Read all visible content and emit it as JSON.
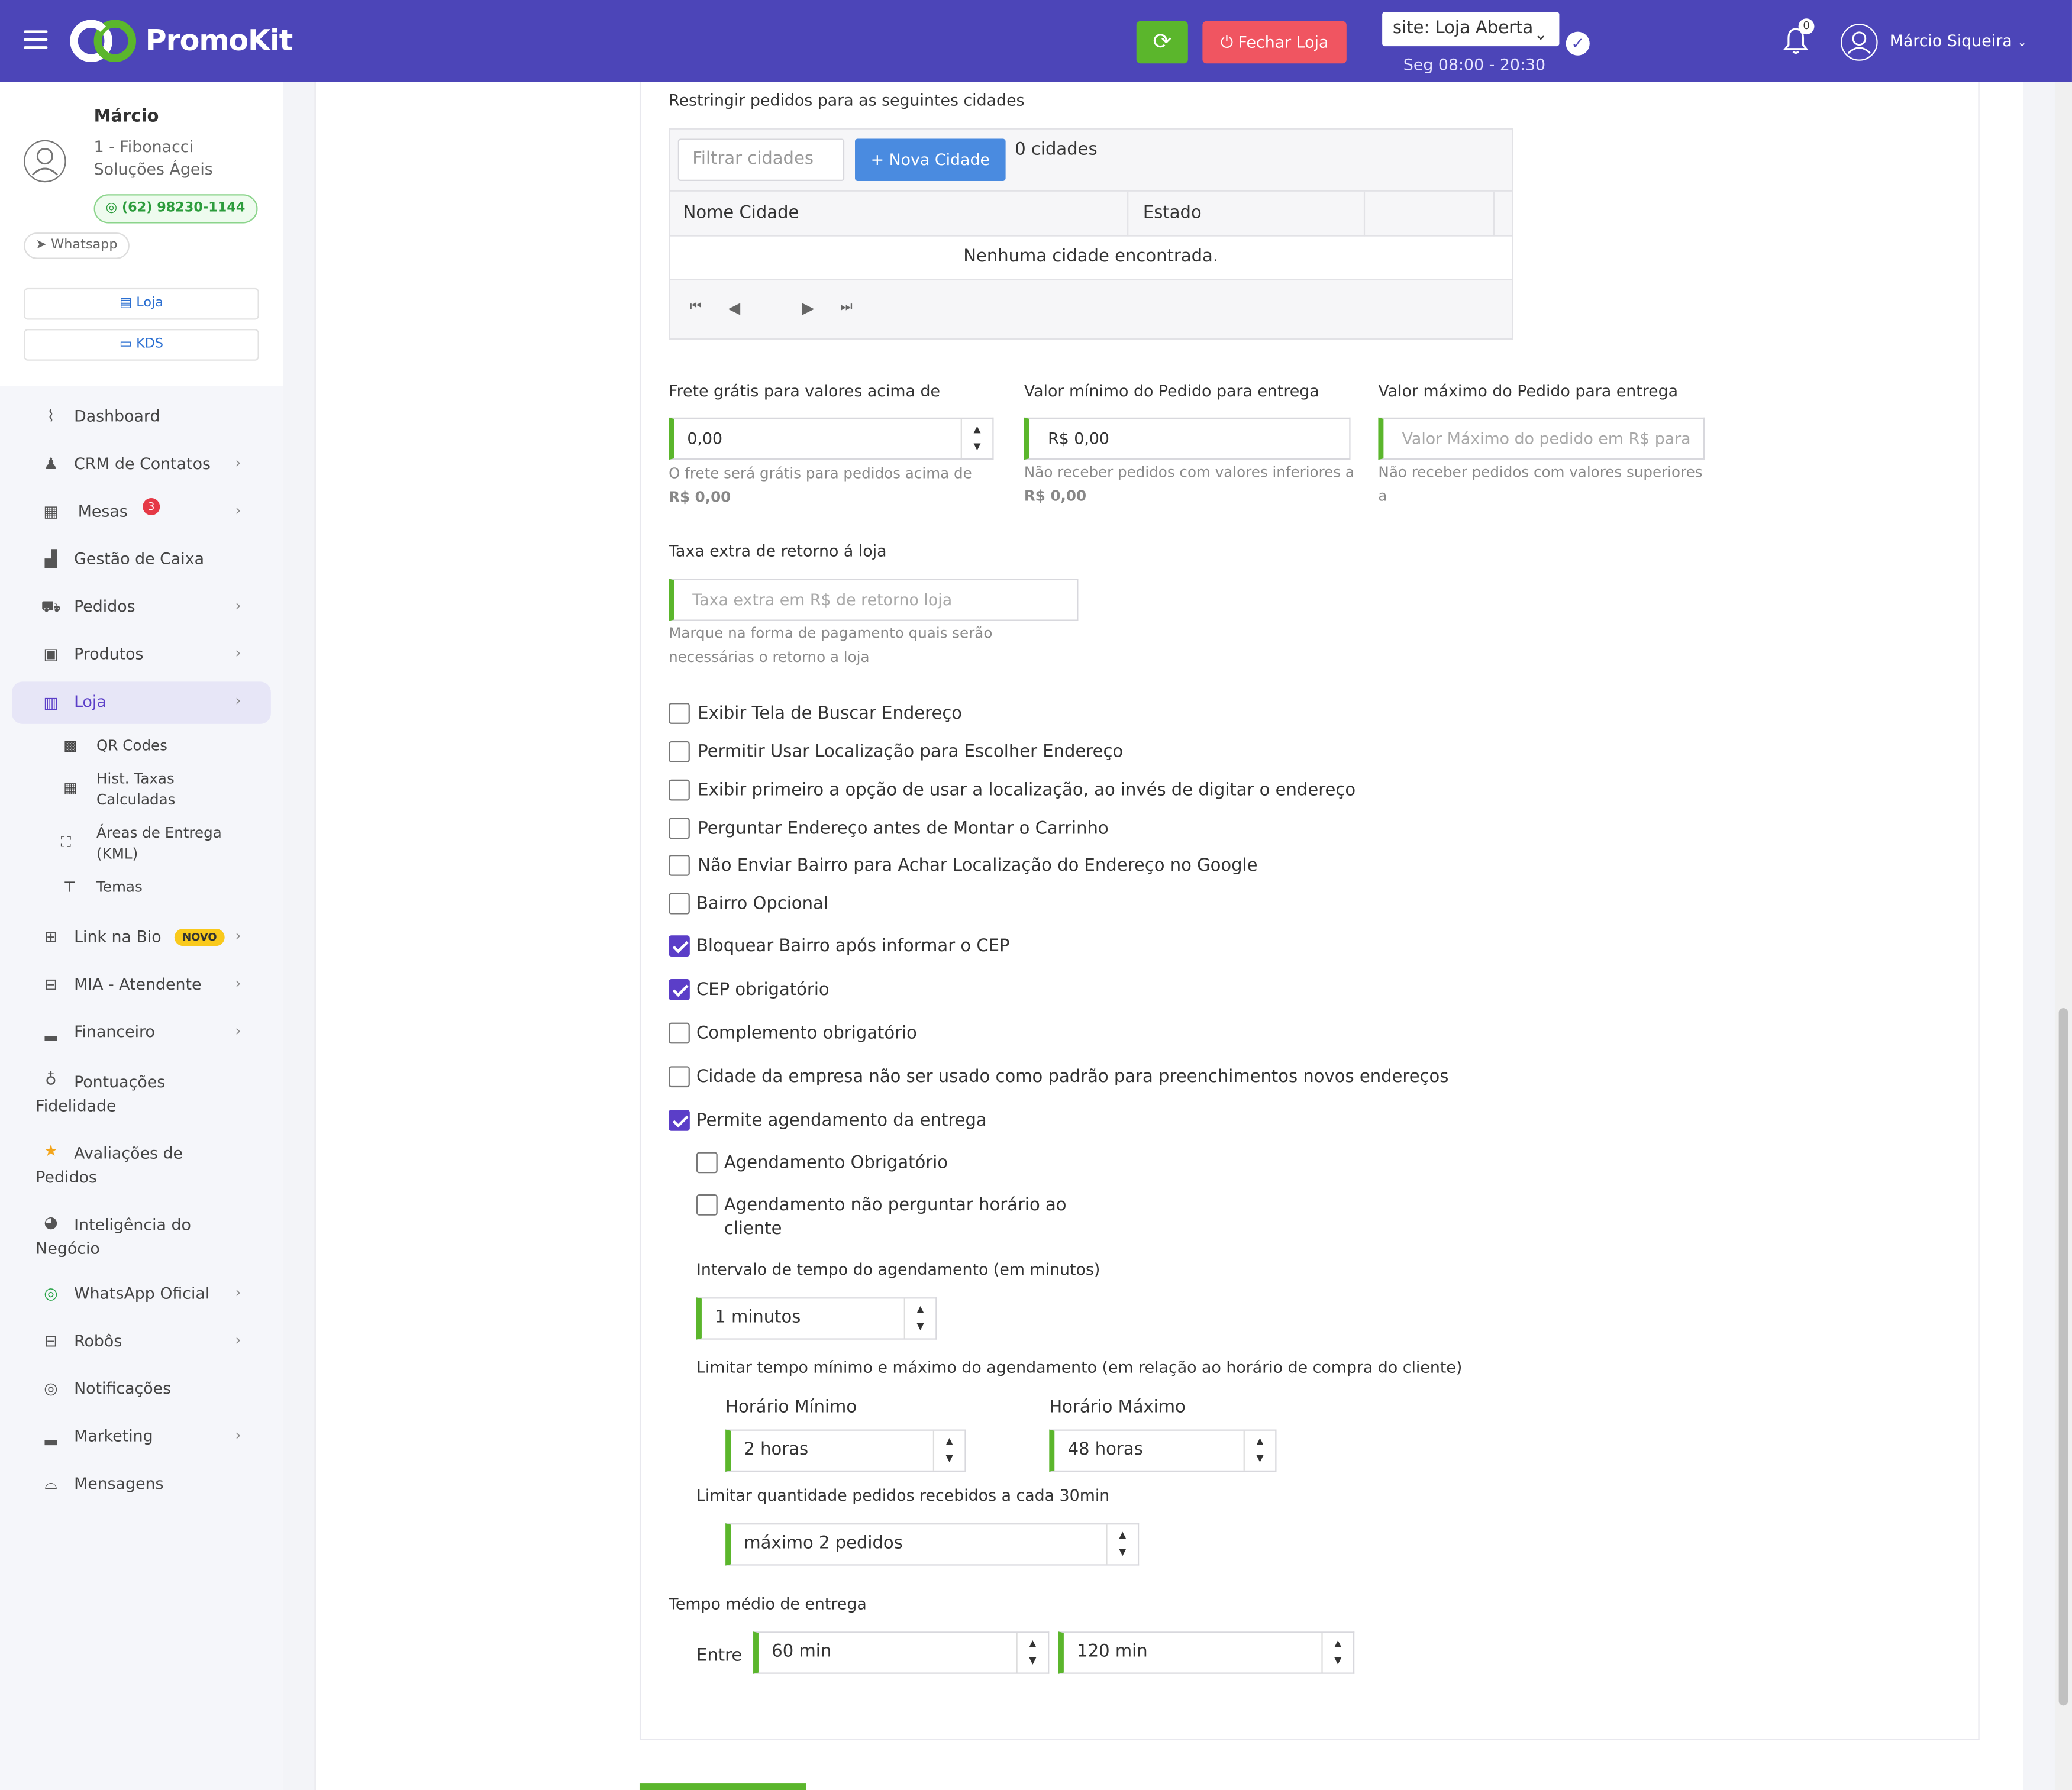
{
  "topbar": {
    "brand": "PromoKit",
    "close_store_label": "Fechar Loja",
    "site_status": "site: Loja Aberta",
    "hours": "Seg 08:00 - 20:30",
    "notifications_count": "0",
    "user_name": "Márcio Siqueira"
  },
  "sidebar": {
    "profile": {
      "name": "Márcio",
      "company": "1 - Fibonacci Soluções Ágeis",
      "phone": "(62) 98230-1144",
      "whatsapp_label": "Whatsapp"
    },
    "quick_buttons": [
      {
        "label": "Loja"
      },
      {
        "label": "KDS"
      }
    ],
    "menu": [
      {
        "label": "Dashboard",
        "icon": "chart-line-icon"
      },
      {
        "label": "CRM de Contatos",
        "icon": "users-icon"
      },
      {
        "label": "Mesas",
        "icon": "table-icon",
        "badge": "3"
      },
      {
        "label": "Gestão de Caixa",
        "icon": "cash-register-icon"
      },
      {
        "label": "Pedidos",
        "icon": "cart-icon"
      },
      {
        "label": "Produtos",
        "icon": "boxes-icon"
      },
      {
        "label": "Loja",
        "icon": "building-icon"
      },
      {
        "label": "Link na Bio",
        "icon": "sitemap-icon",
        "badge": "NOVO"
      },
      {
        "label": "MIA - Atendente",
        "icon": "robot-icon"
      },
      {
        "label": "Financeiro",
        "icon": "bar-chart-icon"
      },
      {
        "label": "Pontuações Fidelidade",
        "icon": "medal-icon"
      },
      {
        "label": "Avaliações de Pedidos",
        "icon": "star-icon"
      },
      {
        "label": "Inteligência do Negócio",
        "icon": "pie-chart-icon"
      },
      {
        "label": "WhatsApp Oficial",
        "icon": "whatsapp-icon"
      },
      {
        "label": "Robôs",
        "icon": "robot-icon"
      },
      {
        "label": "Notificações",
        "icon": "whatsapp-icon"
      },
      {
        "label": "Marketing",
        "icon": "bar-chart-icon"
      },
      {
        "label": "Mensagens",
        "icon": "inbox-icon"
      }
    ],
    "submenu": [
      {
        "label": "QR Codes"
      },
      {
        "label": "Hist. Taxas Calculadas"
      },
      {
        "label": "Áreas de Entrega (KML)"
      },
      {
        "label": "Temas"
      }
    ]
  },
  "cities": {
    "title": "Restringir pedidos para as seguintes cidades",
    "filter_placeholder": "Filtrar cidades",
    "new_city_label": "+ Nova Cidade",
    "count_label": "0 cidades",
    "col_name": "Nome Cidade",
    "col_state": "Estado",
    "empty": "Nenhuma cidade encontrada."
  },
  "fees": {
    "free_shipping_label": "Frete grátis para valores acima de",
    "free_shipping_value": "0,00",
    "free_shipping_help": "O frete será grátis para pedidos acima de",
    "free_shipping_help_value": "R$ 0,00",
    "min_order_label": "Valor mínimo do Pedido para entrega",
    "min_order_value": "R$ 0,00",
    "min_order_help": "Não receber pedidos com valores inferiores a",
    "min_order_help_value": "R$ 0,00",
    "max_order_label": "Valor máximo do Pedido para entrega",
    "max_order_placeholder": "Valor Máximo do pedido em R$ para",
    "max_order_help": "Não receber pedidos com valores superiores a",
    "return_fee_label": "Taxa extra de retorno á loja",
    "return_fee_placeholder": "Taxa extra em R$ de retorno loja",
    "return_fee_help": "Marque na forma de pagamento quais serão necessárias o retorno a loja"
  },
  "options": [
    {
      "label": "Exibir Tela de Buscar Endereço",
      "checked": false
    },
    {
      "label": "Permitir Usar Localização para Escolher Endereço",
      "checked": false
    },
    {
      "label": "Exibir primeiro a opção de usar a localização, ao invés de digitar o endereço",
      "checked": false
    },
    {
      "label": "Perguntar Endereço antes de Montar o Carrinho",
      "checked": false
    },
    {
      "label": "Não Enviar Bairro para Achar Localização do Endereço no Google",
      "checked": false
    },
    {
      "label": "Bairro Opcional",
      "checked": false
    },
    {
      "label": "Bloquear Bairro após informar o CEP",
      "checked": true
    },
    {
      "label": "CEP obrigatório",
      "checked": true
    },
    {
      "label": "Complemento obrigatório",
      "checked": false
    },
    {
      "label": "Cidade da empresa não ser usado como padrão para preenchimentos novos endereços",
      "checked": false
    },
    {
      "label": "Permite agendamento da entrega",
      "checked": true
    }
  ],
  "schedule": {
    "mandatory_label": "Agendamento Obrigatório",
    "no_time_label": "Agendamento não perguntar horário ao cliente",
    "interval_label": "Intervalo de tempo do agendamento (em minutos)",
    "interval_value": "1 minutos",
    "limit_label": "Limitar tempo mínimo e máximo do agendamento (em relação ao horário de compra do cliente)",
    "min_label": "Horário Mínimo",
    "min_value": "2 horas",
    "max_label": "Horário Máximo",
    "max_value": "48 horas",
    "qty_label": "Limitar quantidade pedidos recebidos a cada 30min",
    "qty_value": "máximo 2 pedidos"
  },
  "delivery_time": {
    "label": "Tempo médio de entrega",
    "between": "Entre",
    "from_value": "60 min",
    "to_value": "120 min"
  },
  "colors": {
    "topbar": "#4c45b8",
    "accent_green": "#5bb62c",
    "danger": "#f05561",
    "primary_blue": "#4a8be0",
    "checkbox": "#5b3ec8"
  }
}
